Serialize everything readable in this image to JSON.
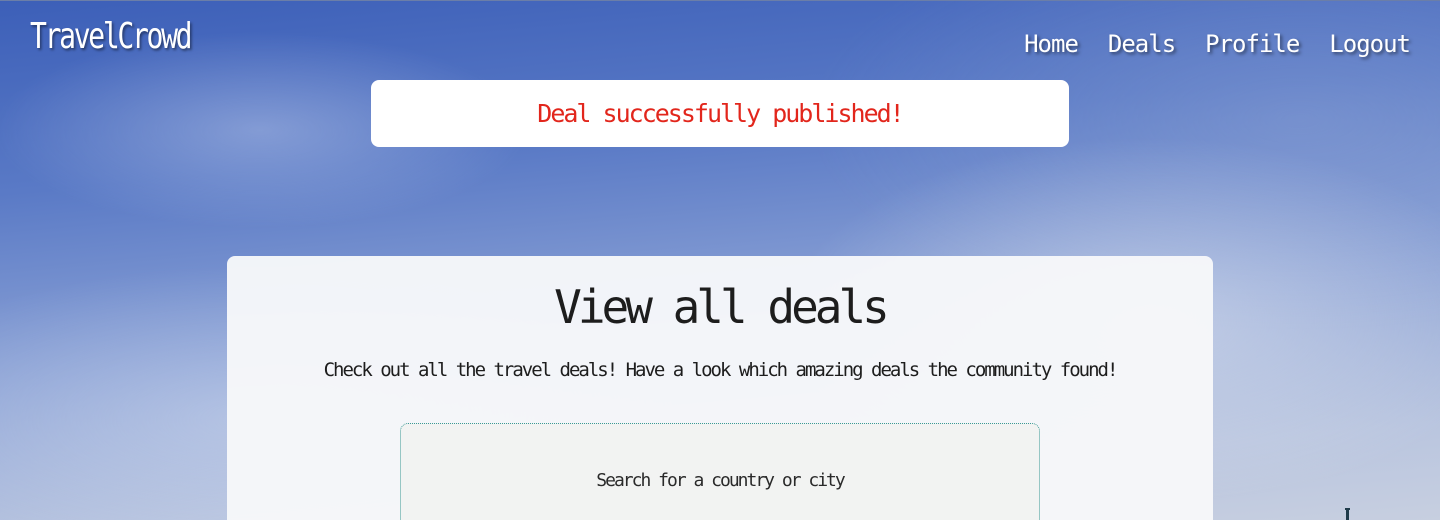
{
  "brand": {
    "title": "TravelCrowd"
  },
  "nav": {
    "items": [
      {
        "label": "Home"
      },
      {
        "label": "Deals"
      },
      {
        "label": "Profile"
      },
      {
        "label": "Logout"
      }
    ]
  },
  "flash": {
    "message": "Deal successfully published!",
    "color": "#e2261c"
  },
  "main": {
    "title": "View all deals",
    "subtitle": "Check out all the travel deals! Have a look which amazing deals the community found!",
    "search": {
      "placeholder": "Search for a country or city"
    }
  }
}
